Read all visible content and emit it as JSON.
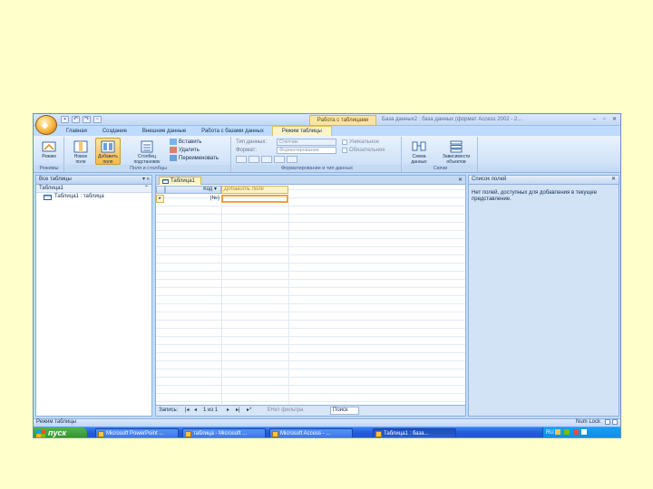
{
  "window": {
    "title": "База данных2 : база данных (формат Access 2002 - 2...",
    "context_tab": "Работа с таблицами",
    "controls": [
      "–",
      "▫",
      "✕"
    ]
  },
  "ribbon_tabs": [
    {
      "label": "Главная"
    },
    {
      "label": "Создание"
    },
    {
      "label": "Внешние данные"
    },
    {
      "label": "Работа с базами данных"
    },
    {
      "label": "Режим таблицы"
    }
  ],
  "ribbon": {
    "groups": [
      {
        "label": "Режимы"
      },
      {
        "label": "Поля и столбцы"
      },
      {
        "label": "Форматирование и тип данных"
      },
      {
        "label": "Связи"
      }
    ],
    "view_button": "Режим",
    "new_field": "Новое поле",
    "add_existing": "Добавить поля",
    "lookup_column": "Столбец подстановок",
    "insert": "Вставить",
    "delete": "Удалить",
    "rename": "Переименовать",
    "data_type_label": "Тип данных:",
    "data_type_value": "Счетчик",
    "format_label": "Формат:",
    "format_value": "Форматирование",
    "unique": "Уникальное",
    "required": "Обязательное",
    "relationships": "Схема данных",
    "dependencies": "Зависимости объектов"
  },
  "nav_pane": {
    "header": "Все таблицы",
    "group": "Таблица1",
    "items": [
      {
        "label": "Таблица1 : таблица"
      }
    ]
  },
  "document": {
    "tab": "Таблица1",
    "columns": [
      "Код",
      "Добавить поле"
    ],
    "rows": [
      {
        "code": "(№)",
        "new": ""
      }
    ]
  },
  "record_nav": {
    "label": "Запись:",
    "position": "1 из 1",
    "filter": "Нет фильтра",
    "search": "Поиск"
  },
  "field_list": {
    "title": "Список полей",
    "message": "Нет полей, доступных для добавления в текущее представление."
  },
  "status": {
    "left": "Режим таблицы",
    "right": "Num Lock"
  },
  "taskbar": {
    "start": "пуск",
    "buttons": [
      {
        "label": "Microsoft PowerPoint ..."
      },
      {
        "label": "таблица - Microsoft ..."
      },
      {
        "label": "Microsoft Access - ..."
      },
      {
        "label": "Таблица1 : база..."
      }
    ],
    "tray_text": "RU"
  },
  "colors": {
    "background": "#ffffcc",
    "ribbon": "#d2e4f9",
    "accent": "#f8b94a",
    "taskbar": "#245edb",
    "start": "#2f8c2b"
  }
}
